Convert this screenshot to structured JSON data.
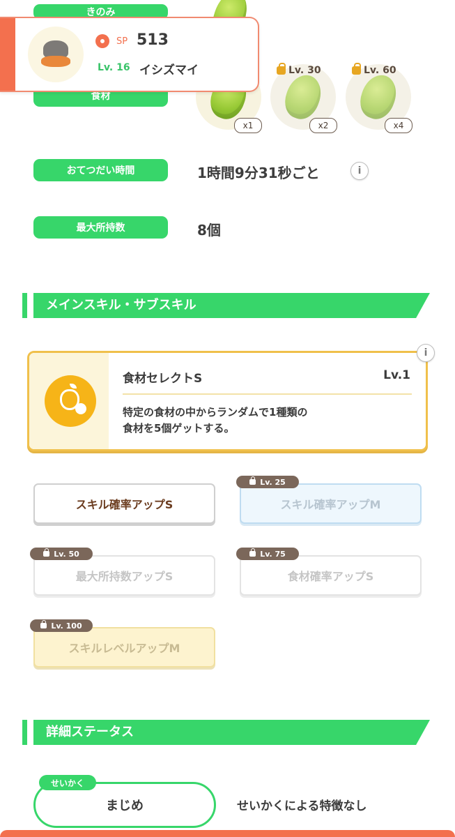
{
  "labels": {
    "berry": "きのみ",
    "ingredients": "食材",
    "help_time": "おてつだい時間",
    "max_carry": "最大所持数"
  },
  "values": {
    "help_time": "1時間9分31秒ごと",
    "max_carry": "8個"
  },
  "header": {
    "sp_label": "SP",
    "sp_value": "513",
    "level": "Lv. 16",
    "species": "イシズマイ"
  },
  "ingredients": [
    {
      "count": "x1",
      "locked": false,
      "lock_level": ""
    },
    {
      "count": "x2",
      "locked": true,
      "lock_level": "Lv. 30"
    },
    {
      "count": "x4",
      "locked": true,
      "lock_level": "Lv. 60"
    }
  ],
  "sections": {
    "skills": "メインスキル・サブスキル",
    "details": "詳細ステータス"
  },
  "main_skill": {
    "name": "食材セレクトS",
    "level": "Lv.1",
    "desc_line1": "特定の食材の中からランダムで1種類の",
    "desc_line2": "食材を5個ゲットする。"
  },
  "sub_skills": [
    {
      "name": "スキル確率アップS",
      "lock_level": "",
      "state": "unlocked"
    },
    {
      "name": "スキル確率アップM",
      "lock_level": "Lv. 25",
      "state": "locked"
    },
    {
      "name": "最大所持数アップS",
      "lock_level": "Lv. 50",
      "state": "locked"
    },
    {
      "name": "食材確率アップS",
      "lock_level": "Lv. 75",
      "state": "locked"
    },
    {
      "name": "スキルレベルアップM",
      "lock_level": "Lv. 100",
      "state": "locked"
    }
  ],
  "nature": {
    "tag": "せいかく",
    "value": "まじめ",
    "effect": "せいかくによる特徴なし"
  },
  "icons": {
    "info": "i",
    "sp": "pokeball-icon",
    "lock": "lock-icon",
    "skill": "apple-check-icon"
  },
  "colors": {
    "accent_green": "#37d66a",
    "accent_red": "#f3704e",
    "skill_gold": "#f0c04b"
  }
}
